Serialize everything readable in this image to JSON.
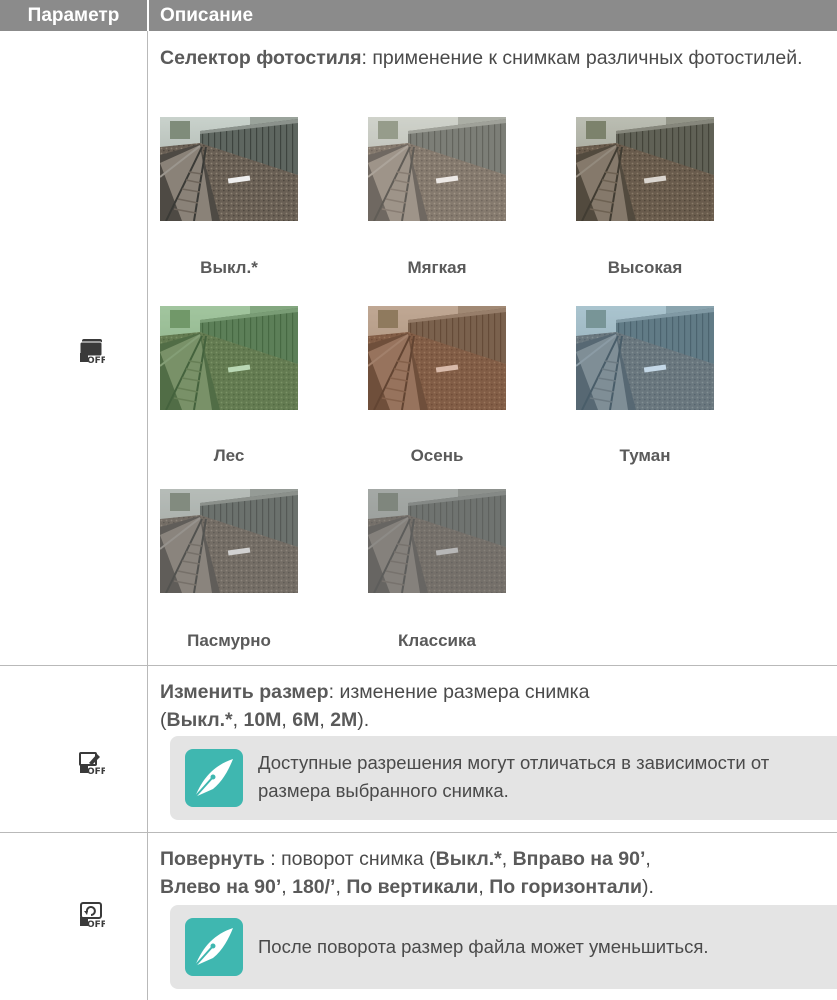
{
  "header": {
    "param": "Параметр",
    "desc": "Описание"
  },
  "style_selector": {
    "title": "Селектор фотостиля",
    "text": ": применение к снимкам различных фотостилей.",
    "photos": [
      {
        "label": "Выкл.*",
        "tint": "#000000",
        "tint_opacity": 0
      },
      {
        "label": "Мягкая",
        "tint": "#e7d8c8",
        "tint_opacity": 0.22
      },
      {
        "label": "Высокая",
        "tint": "#6a4a22",
        "tint_opacity": 0.15
      },
      {
        "label": "Лес",
        "tint": "#5ab04a",
        "tint_opacity": 0.35
      },
      {
        "label": "Осень",
        "tint": "#b0582a",
        "tint_opacity": 0.35
      },
      {
        "label": "Туман",
        "tint": "#6aa8d8",
        "tint_opacity": 0.32
      },
      {
        "label": "Пасмурно",
        "tint": "#8a8a8a",
        "tint_opacity": 0.3
      },
      {
        "label": "Классика",
        "tint": "#808080",
        "tint_opacity": 0.5
      }
    ]
  },
  "resize": {
    "title": "Изменить размер",
    "text1": ": изменение размера снимка",
    "open": "(",
    "opt1": "Выкл.*",
    "sep1": ", ",
    "opt2": "10M",
    "sep2": ", ",
    "opt3": "6M",
    "sep3": ", ",
    "opt4": "2M",
    "close": ").",
    "note": "Доступные разрешения могут отличаться в зависимости от размера выбранного снимка."
  },
  "rotate": {
    "title": "Повернуть",
    "text1": " : поворот снимка (",
    "opt1": "Выкл.*",
    "sep1": ", ",
    "opt2": "Вправо на 90’",
    "sep2": ", ",
    "opt3": "Влево на 90’",
    "sep3": ", ",
    "opt4": "180/’",
    "sep4": ", ",
    "opt5": "По вертикали",
    "sep5": ", ",
    "opt6": "По горизонтали",
    "close": ").",
    "note": "После поворота размер файла может уменьшиться."
  },
  "colors": {
    "header_bg": "#8b8b8b",
    "note_bg": "#e4e4e4",
    "pen_teal": "#3fb7b0",
    "text": "#4a4a4a"
  },
  "icons": [
    "photo-style-off-icon",
    "resize-off-icon",
    "rotate-off-icon",
    "pen-note-icon"
  ]
}
